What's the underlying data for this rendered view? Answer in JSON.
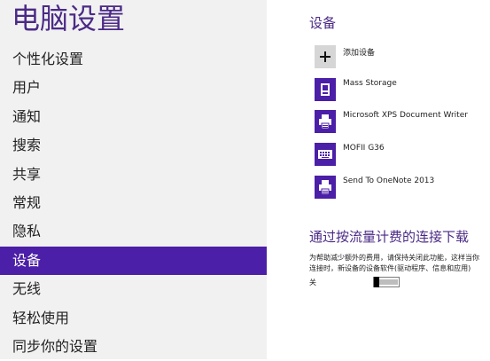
{
  "app": {
    "title": "电脑设置"
  },
  "nav": {
    "items": [
      {
        "label": "个性化设置"
      },
      {
        "label": "用户"
      },
      {
        "label": "通知"
      },
      {
        "label": "搜索"
      },
      {
        "label": "共享"
      },
      {
        "label": "常规"
      },
      {
        "label": "隐私"
      },
      {
        "label": "设备",
        "selected": true
      },
      {
        "label": "无线"
      },
      {
        "label": "轻松使用"
      },
      {
        "label": "同步你的设置"
      }
    ]
  },
  "devices": {
    "title": "设备",
    "add_label": "添加设备",
    "items": [
      {
        "label": "Mass Storage",
        "icon": "storage-icon"
      },
      {
        "label": "Microsoft XPS Document Writer",
        "icon": "printer-icon"
      },
      {
        "label": "MOFII G36",
        "icon": "keyboard-icon"
      },
      {
        "label": "Send To OneNote 2013",
        "icon": "printer-icon"
      }
    ]
  },
  "metered": {
    "title": "通过按流量计费的连接下载",
    "description_line1": "为帮助减少额外的费用，请保持关闭此功能，这样当你",
    "description_line2": "连接时，新设备的设备软件(驱动程序、信息和应用)",
    "toggle_state_label": "关",
    "toggle_on": false
  },
  "colors": {
    "accent": "#4b1fa7",
    "title": "#4b2a86",
    "left_bg": "#f1f1f1",
    "add_icon_bg": "#d6d6d6"
  }
}
